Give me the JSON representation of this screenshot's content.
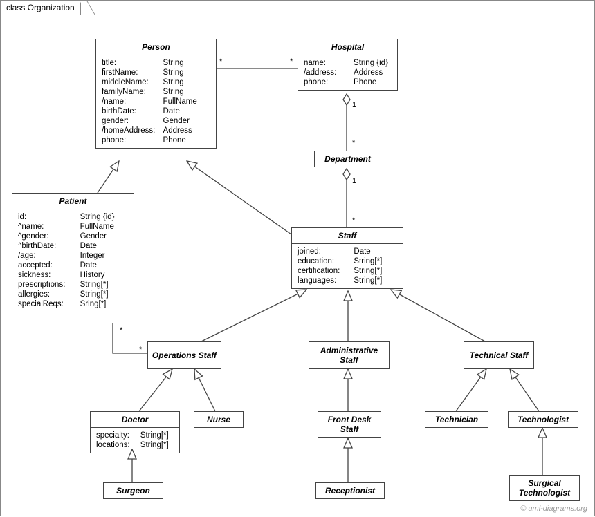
{
  "frameTitle": "class Organization",
  "copyright": "© uml-diagrams.org",
  "classes": {
    "person": {
      "name": "Person",
      "attrs": [
        [
          "title:",
          "String"
        ],
        [
          "firstName:",
          "String"
        ],
        [
          "middleName:",
          "String"
        ],
        [
          "familyName:",
          "String"
        ],
        [
          "/name:",
          "FullName"
        ],
        [
          "birthDate:",
          "Date"
        ],
        [
          "gender:",
          "Gender"
        ],
        [
          "/homeAddress:",
          "Address"
        ],
        [
          "phone:",
          "Phone"
        ]
      ]
    },
    "hospital": {
      "name": "Hospital",
      "attrs": [
        [
          "name:",
          "String {id}"
        ],
        [
          "/address:",
          "Address"
        ],
        [
          "phone:",
          "Phone"
        ]
      ]
    },
    "department": {
      "name": "Department"
    },
    "patient": {
      "name": "Patient",
      "attrs": [
        [
          "id:",
          "String {id}"
        ],
        [
          "^name:",
          "FullName"
        ],
        [
          "^gender:",
          "Gender"
        ],
        [
          "^birthDate:",
          "Date"
        ],
        [
          "/age:",
          "Integer"
        ],
        [
          "accepted:",
          "Date"
        ],
        [
          "sickness:",
          "History"
        ],
        [
          "prescriptions:",
          "String[*]"
        ],
        [
          "allergies:",
          "String[*]"
        ],
        [
          "specialReqs:",
          "Sring[*]"
        ]
      ]
    },
    "staff": {
      "name": "Staff",
      "attrs": [
        [
          "joined:",
          "Date"
        ],
        [
          "education:",
          "String[*]"
        ],
        [
          "certification:",
          "String[*]"
        ],
        [
          "languages:",
          "String[*]"
        ]
      ]
    },
    "opsStaff": {
      "name": "Operations Staff"
    },
    "adminStaff": {
      "name": "Administrative Staff"
    },
    "techStaff": {
      "name": "Technical Staff"
    },
    "doctor": {
      "name": "Doctor",
      "attrs": [
        [
          "specialty:",
          "String[*]"
        ],
        [
          "locations:",
          "String[*]"
        ]
      ]
    },
    "nurse": {
      "name": "Nurse"
    },
    "frontDesk": {
      "name": "Front Desk Staff"
    },
    "technician": {
      "name": "Technician"
    },
    "technologist": {
      "name": "Technologist"
    },
    "surgeon": {
      "name": "Surgeon"
    },
    "receptionist": {
      "name": "Receptionist"
    },
    "surgTech": {
      "name": "Surgical Technologist"
    }
  },
  "multiplicities": {
    "personHospital_p": "*",
    "personHospital_h": "*",
    "hospDept_h": "1",
    "hospDept_d": "*",
    "deptStaff_d": "1",
    "deptStaff_s": "*",
    "patientOps_p": "*",
    "patientOps_o": "*"
  }
}
